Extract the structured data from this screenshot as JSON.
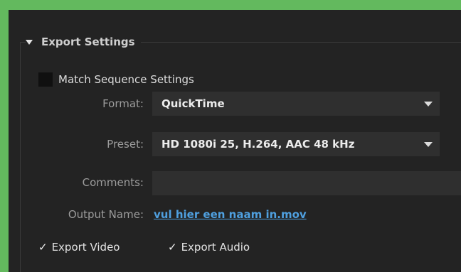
{
  "section": {
    "title": "Export Settings"
  },
  "match_sequence": {
    "label": "Match Sequence Settings"
  },
  "format": {
    "label": "Format:",
    "value": "QuickTime"
  },
  "preset": {
    "label": "Preset:",
    "value": "HD 1080i 25, H.264, AAC 48 kHz"
  },
  "comments": {
    "label": "Comments:",
    "value": ""
  },
  "output": {
    "label": "Output Name:",
    "value": "vul hier een naam in.mov"
  },
  "export_video": {
    "label": "Export Video",
    "checked": true
  },
  "export_audio": {
    "label": "Export Audio",
    "checked": true
  },
  "colors": {
    "background": "#63b95e",
    "panel": "#232323",
    "link": "#4fa0e0"
  },
  "icons": {
    "section_toggle": "triangle-down-icon",
    "dropdown": "chevron-down-icon",
    "check": "checkmark-icon"
  }
}
